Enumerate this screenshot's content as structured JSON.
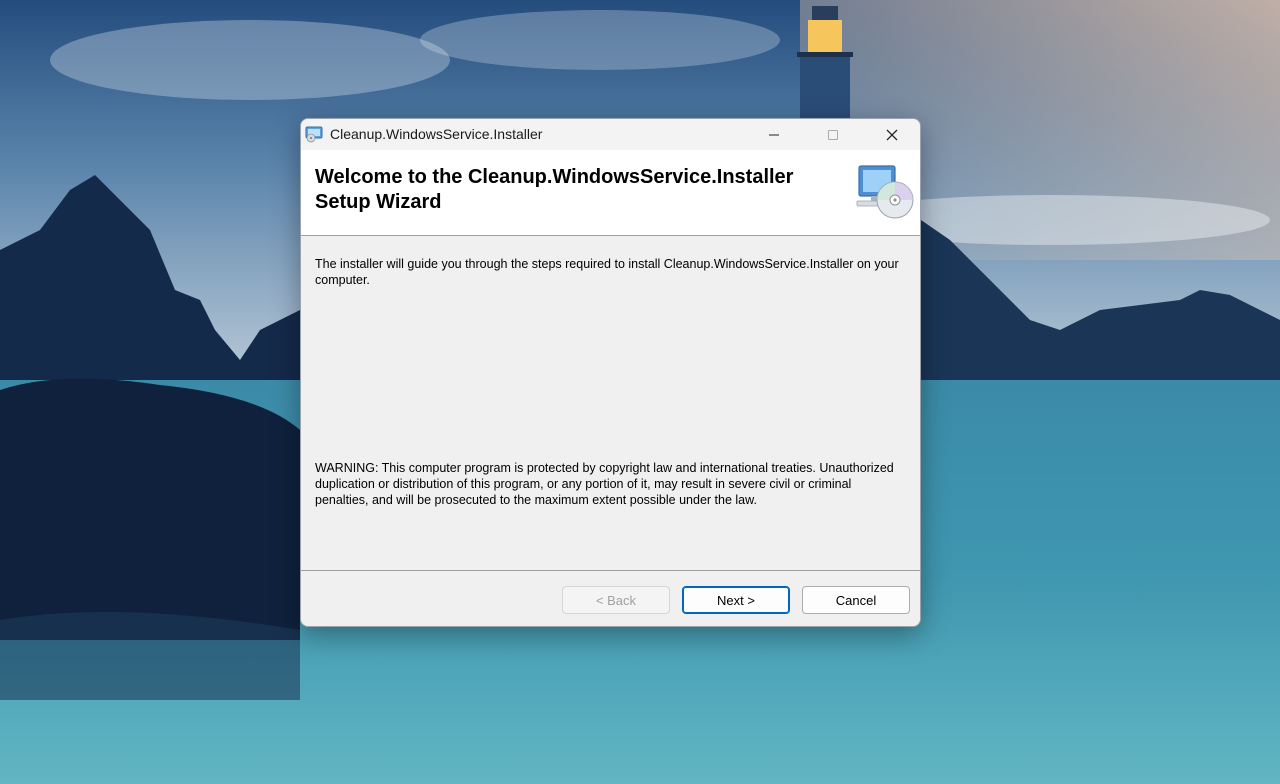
{
  "window": {
    "title": "Cleanup.WindowsService.Installer"
  },
  "banner": {
    "title_line1": "Welcome to the Cleanup.WindowsService.Installer",
    "title_line2": "Setup Wizard",
    "icon": "computer-cd-icon"
  },
  "body": {
    "intro": "The installer will guide you through the steps required to install Cleanup.WindowsService.Installer on your computer.",
    "warning": "WARNING: This computer program is protected by copyright law and international treaties. Unauthorized duplication or distribution of this program, or any portion of it, may result in severe civil or criminal penalties, and will be prosecuted to the maximum extent possible under the law."
  },
  "buttons": {
    "back": "< Back",
    "next": "Next >",
    "cancel": "Cancel"
  },
  "colors": {
    "accent": "#0067c0",
    "disabled_text": "#a0a0a0"
  }
}
